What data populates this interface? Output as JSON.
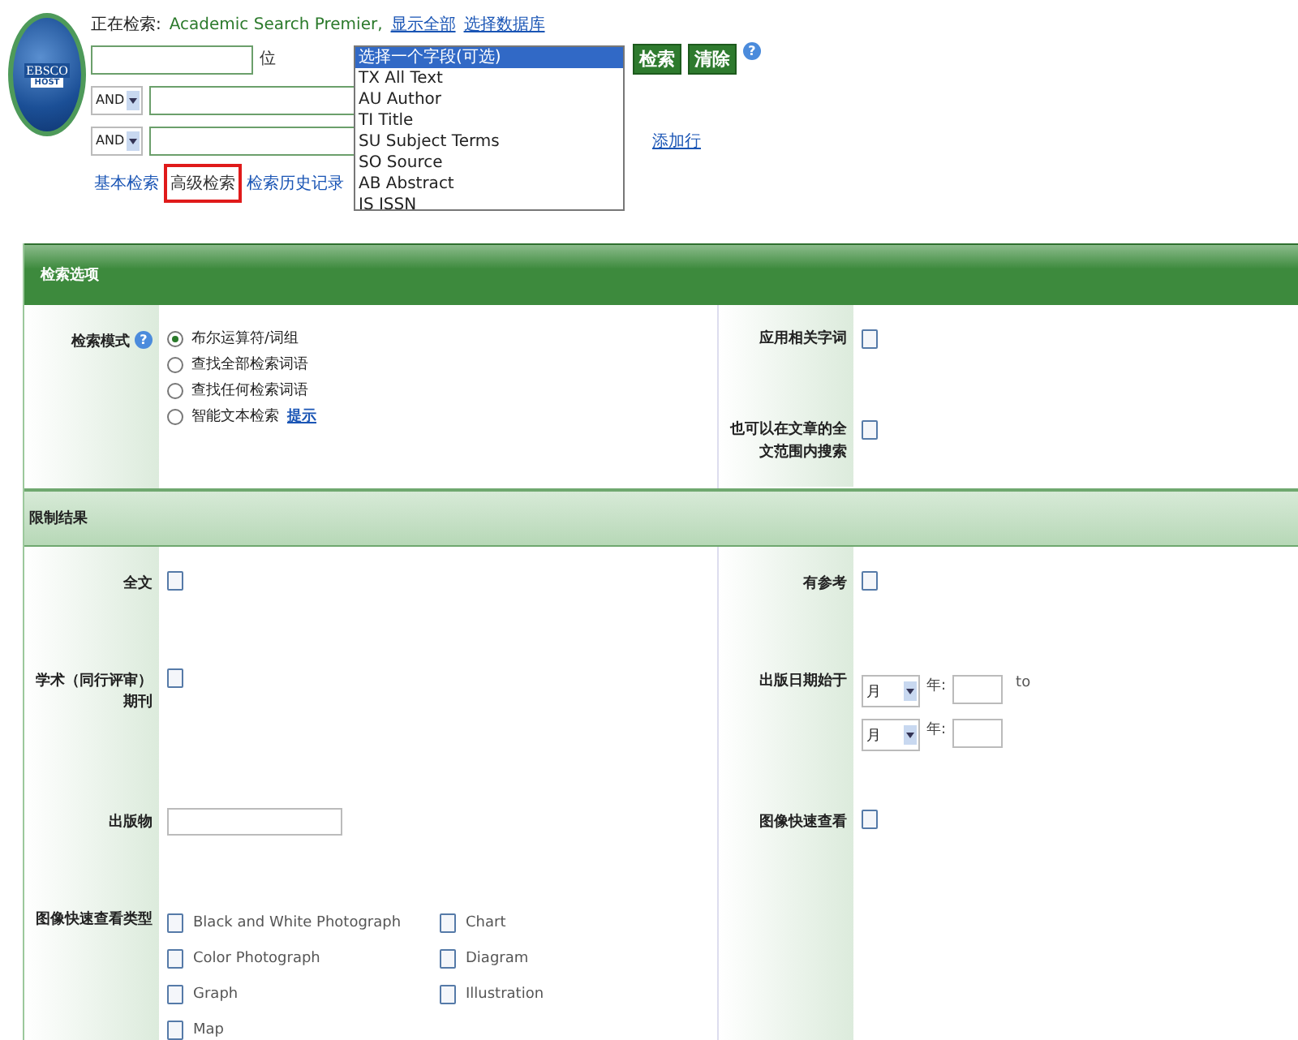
{
  "logo": {
    "line1": "EBSCO",
    "line2": "HOST"
  },
  "header": {
    "searching_label": "正在检索:",
    "database": "Academic Search Premier,",
    "links": [
      "显示全部",
      "选择数据库"
    ]
  },
  "search_rows": [
    {
      "field_text": "位"
    },
    {
      "operator": "AND"
    },
    {
      "operator": "AND"
    }
  ],
  "add_row_link": "添加行",
  "field_dropdown": {
    "options": [
      {
        "label": "选择一个字段(可选)",
        "selected": true
      },
      {
        "label": "TX All Text",
        "selected": false
      },
      {
        "label": "AU Author",
        "selected": false
      },
      {
        "label": "TI Title",
        "selected": false
      },
      {
        "label": "SU Subject Terms",
        "selected": false
      },
      {
        "label": "SO Source",
        "selected": false
      },
      {
        "label": "AB Abstract",
        "selected": false
      },
      {
        "label": "IS ISSN",
        "selected": false
      }
    ]
  },
  "buttons": [
    "检索",
    "清除"
  ],
  "help_mark": "?",
  "search_tabs": [
    {
      "label": "基本检索",
      "selected": false
    },
    {
      "label": "高级检索",
      "selected": true
    },
    {
      "label": "检索历史记录",
      "selected": false
    }
  ],
  "search_options": {
    "title": "检索选项",
    "mode_label": "检索模式",
    "help_mark": "?",
    "modes": [
      {
        "label": "布尔运算符/词组",
        "selected": true
      },
      {
        "label": "查找全部检索词语",
        "selected": false
      },
      {
        "label": "查找任何检索词语",
        "selected": false
      },
      {
        "label": "智能文本检索",
        "selected": false,
        "link": "提示"
      }
    ],
    "options": [
      {
        "label": "应用相关字词",
        "checked": false
      },
      {
        "label": "也可以在文章的全文范围内搜索",
        "checked": false
      }
    ]
  },
  "limits": {
    "title": "限制结果",
    "rows": [
      {
        "left": {
          "kind": "checkbox",
          "label": "全文",
          "checked": false
        },
        "right": {
          "kind": "checkbox",
          "label": "有参考",
          "checked": false
        }
      },
      {
        "left": {
          "kind": "checkbox",
          "label": "学术（同行评审）期刊",
          "checked": false
        },
        "right": {
          "kind": "date",
          "label": "出版日期始于",
          "ranges": [
            {
              "month": "月",
              "year_label": "年:",
              "suffix": "to"
            },
            {
              "month": "月",
              "year_label": "年:"
            }
          ]
        }
      },
      {
        "left": {
          "kind": "text",
          "label": "出版物"
        },
        "right": {
          "kind": "checkbox",
          "label": "图像快速查看",
          "checked": false
        }
      },
      {
        "left": {
          "kind": "checklist",
          "label": "图像快速查看类型",
          "items": [
            {
              "label": "Black and White Photograph",
              "checked": false
            },
            {
              "label": "Color Photograph",
              "checked": false
            },
            {
              "label": "Graph",
              "checked": false
            },
            {
              "label": "Map",
              "checked": false
            },
            {
              "label": "Chart",
              "checked": false
            },
            {
              "label": "Diagram",
              "checked": false
            },
            {
              "label": "Illustration",
              "checked": false
            }
          ]
        }
      }
    ]
  }
}
